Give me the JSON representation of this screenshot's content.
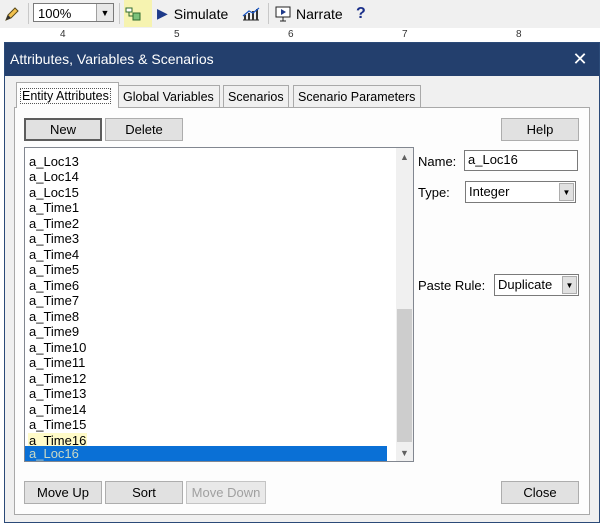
{
  "toolbar": {
    "zoom_value": "100%",
    "simulate_label": "Simulate",
    "narrate_label": "Narrate",
    "help_glyph": "?"
  },
  "ruler": {
    "ticks": [
      "4",
      "5",
      "6",
      "7",
      "8"
    ]
  },
  "dialog": {
    "title": "Attributes, Variables & Scenarios",
    "close_glyph": "✕",
    "tabs": [
      "Entity Attributes",
      "Global Variables",
      "Scenarios",
      "Scenario Parameters"
    ],
    "buttons": {
      "new": "New",
      "delete": "Delete",
      "help": "Help",
      "move_up": "Move Up",
      "sort": "Sort",
      "move_down": "Move Down",
      "close": "Close"
    },
    "attributes": [
      "a_Loc13",
      "a_Loc14",
      "a_Loc15",
      "a_Time1",
      "a_Time2",
      "a_Time3",
      "a_Time4",
      "a_Time5",
      "a_Time6",
      "a_Time7",
      "a_Time8",
      "a_Time9",
      "a_Time10",
      "a_Time11",
      "a_Time12",
      "a_Time13",
      "a_Time14",
      "a_Time15",
      "a_Time16",
      "a_Loc16"
    ],
    "selected_attribute": "a_Loc16",
    "fields": {
      "name_label": "Name:",
      "name_value": "a_Loc16",
      "type_label": "Type:",
      "type_value": "Integer",
      "paste_rule_label": "Paste Rule:",
      "paste_rule_value": "Duplicate"
    }
  },
  "colors": {
    "title_bar": "#233f6d",
    "selection": "#0a70d6",
    "highlight": "#fffbc8"
  }
}
